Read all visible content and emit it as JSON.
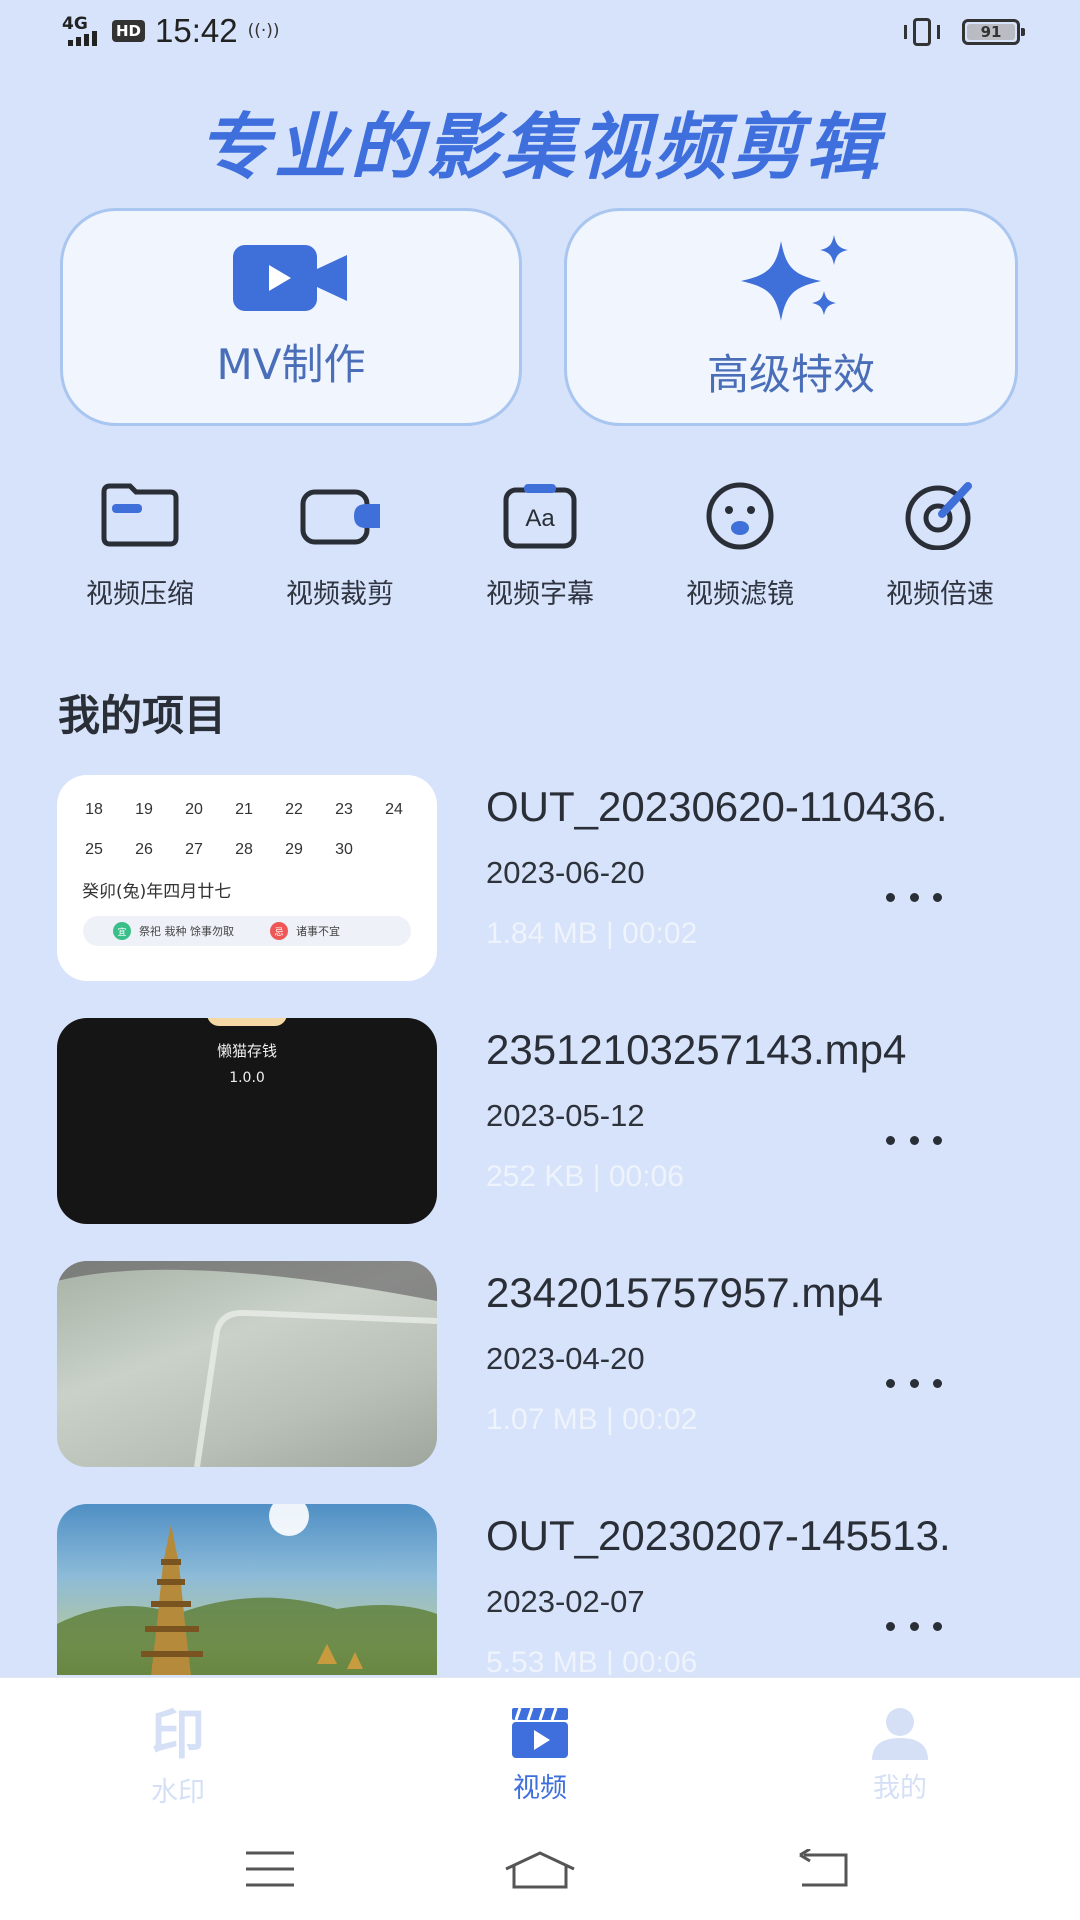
{
  "status_bar": {
    "network": "4G",
    "hd": "HD",
    "time": "15:42",
    "battery": "91"
  },
  "header": {
    "title": "专业的影集视频剪辑"
  },
  "feature_cards": {
    "mv": {
      "label": "MV制作",
      "icon": "video-camera-icon"
    },
    "effects": {
      "label": "高级特效",
      "icon": "sparkle-icon"
    }
  },
  "tools": [
    {
      "label": "视频压缩",
      "icon": "folder-icon"
    },
    {
      "label": "视频裁剪",
      "icon": "crop-camera-icon"
    },
    {
      "label": "视频字幕",
      "icon": "subtitle-aa-icon"
    },
    {
      "label": "视频滤镜",
      "icon": "filter-face-icon"
    },
    {
      "label": "视频倍速",
      "icon": "speed-dial-icon"
    }
  ],
  "projects_section": {
    "title": "我的项目"
  },
  "projects": [
    {
      "name": "OUT_20230620-110436.",
      "date": "2023-06-20",
      "meta": "1.84 MB | 00:02"
    },
    {
      "name": "23512103257143.mp4",
      "date": "2023-05-12",
      "meta": "252 KB | 00:06"
    },
    {
      "name": "2342015757957.mp4",
      "date": "2023-04-20",
      "meta": "1.07 MB | 00:02"
    },
    {
      "name": "OUT_20230207-145513.",
      "date": "2023-02-07",
      "meta": "5.53 MB | 00:06"
    }
  ],
  "thumb_calendar": {
    "row1": [
      "18",
      "19",
      "20",
      "21",
      "22",
      "23",
      "24"
    ],
    "row2": [
      "25",
      "26",
      "27",
      "28",
      "29",
      "30",
      ""
    ],
    "lunar": "癸卯(兔)年四月廿七",
    "good_badge": "宜",
    "good_text": "祭祀 栽种 馀事勿取",
    "bad_badge": "忌",
    "bad_text": "诸事不宜"
  },
  "thumb_app": {
    "title": "懒猫存钱",
    "version": "1.0.0"
  },
  "bottom_nav": {
    "watermark": {
      "label": "水印",
      "glyph": "印"
    },
    "video": {
      "label": "视频"
    },
    "mine": {
      "label": "我的"
    }
  },
  "colors": {
    "background": "#d6e3fb",
    "accent": "#3e6fdc",
    "card_border": "#a9c6f0",
    "inactive_nav": "#d5e0f6"
  }
}
